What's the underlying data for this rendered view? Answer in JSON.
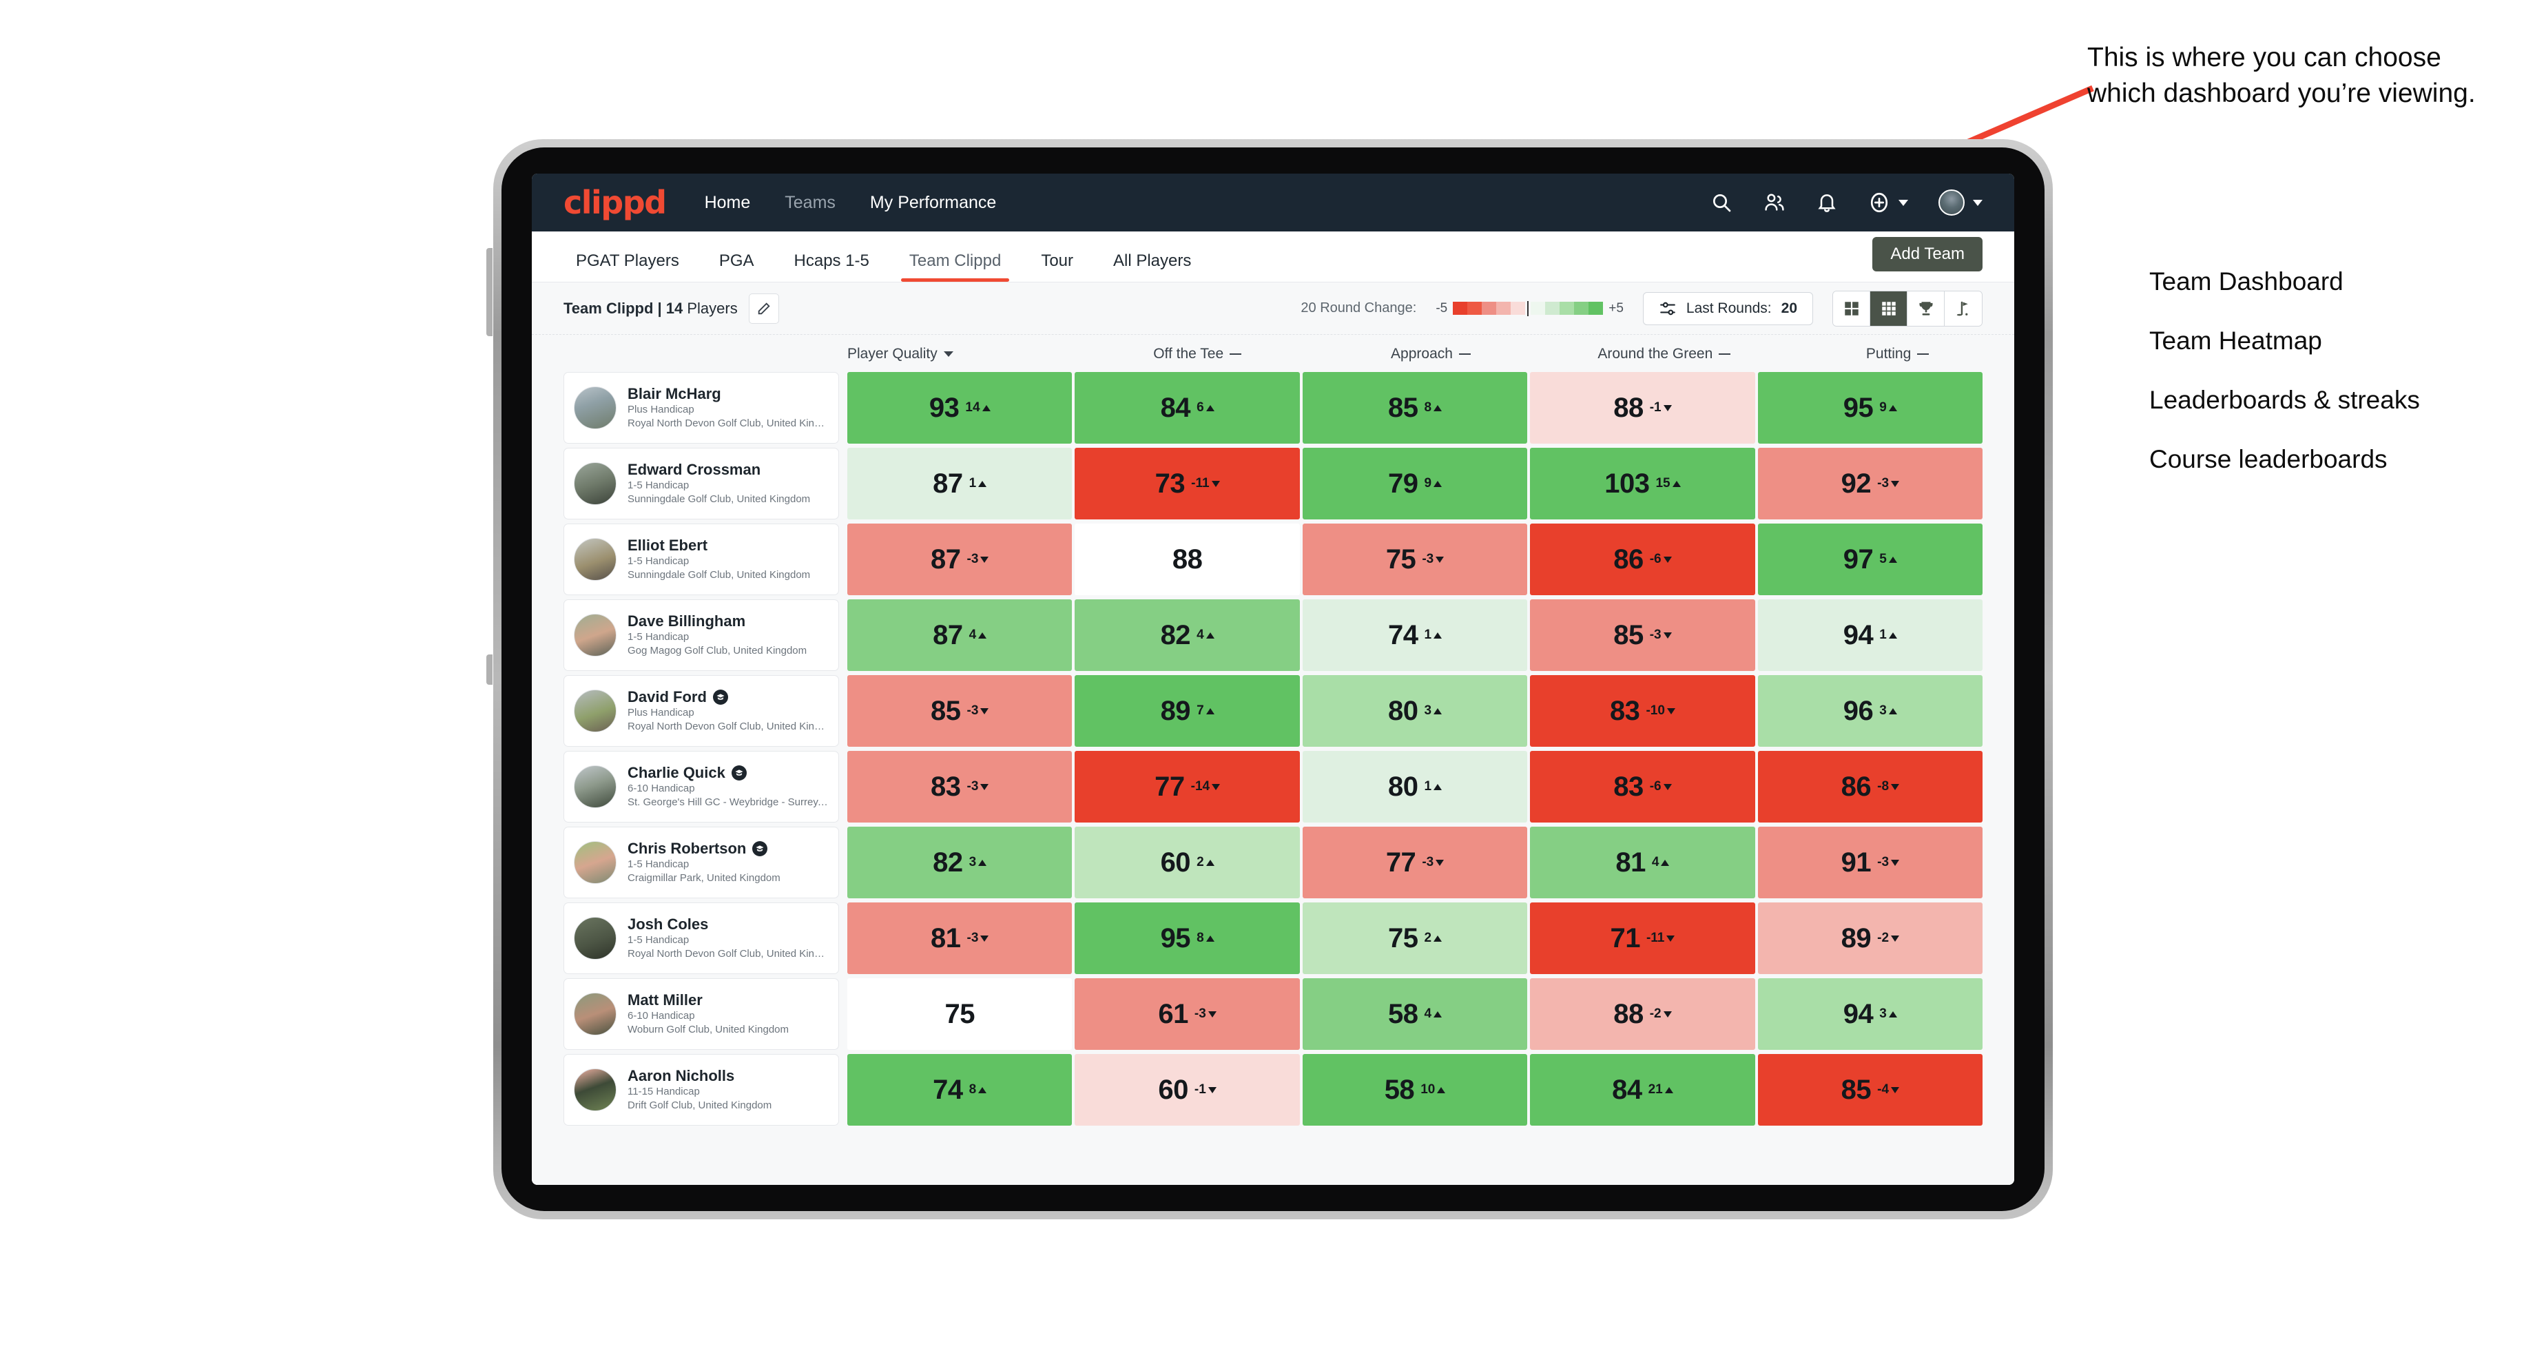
{
  "brand": {
    "logo_text": "clippd",
    "accent": "#f04a33"
  },
  "topnav": {
    "items": [
      {
        "label": "Home",
        "active": true
      },
      {
        "label": "Teams",
        "active": false
      },
      {
        "label": "My Performance",
        "active": false
      }
    ],
    "icons": [
      "search-icon",
      "people-icon",
      "bell-icon",
      "plus-circle-icon",
      "avatar"
    ]
  },
  "tabs": [
    {
      "label": "PGAT Players",
      "active": false
    },
    {
      "label": "PGA",
      "active": false
    },
    {
      "label": "Hcaps 1-5",
      "active": false
    },
    {
      "label": "Team Clippd",
      "active": true
    },
    {
      "label": "Tour",
      "active": false
    },
    {
      "label": "All Players",
      "active": false
    }
  ],
  "add_team_button": "Add Team",
  "controls": {
    "team_label_bold": "Team Clippd | 14",
    "team_label_rest": " Players",
    "edit_icon": "pencil-icon",
    "round_change_label": "20 Round Change:",
    "scale_min": "-5",
    "scale_max": "+5",
    "last_rounds_label": "Last Rounds:",
    "last_rounds_value": "20",
    "filter_icon": "sliders-icon",
    "views": [
      {
        "name": "team-dashboard",
        "icon": "grid-2x2-icon",
        "active": false
      },
      {
        "name": "team-heatmap",
        "icon": "grid-3x3-icon",
        "active": true
      },
      {
        "name": "leaderboards-streaks",
        "icon": "trophy-icon",
        "active": false
      },
      {
        "name": "course-leaderboards",
        "icon": "flag-icon",
        "active": false
      }
    ]
  },
  "columns": [
    {
      "label": "Player Quality",
      "indicator": "chevron-down-icon"
    },
    {
      "label": "Off the Tee",
      "indicator": "dash-icon"
    },
    {
      "label": "Approach",
      "indicator": "dash-icon"
    },
    {
      "label": "Around the Green",
      "indicator": "dash-icon"
    },
    {
      "label": "Putting",
      "indicator": "dash-icon"
    }
  ],
  "rows": [
    {
      "name": "Blair McHarg",
      "badge": false,
      "handicap": "Plus Handicap",
      "club": "Royal North Devon Golf Club, United Kingdom",
      "avatar_bg": "linear-gradient(160deg,#b9c3c9 0%,#8fa0a6 40%,#6f7c6b 100%)",
      "cells": [
        {
          "value": "93",
          "delta": "14",
          "dir": "up",
          "bg": "#61c263"
        },
        {
          "value": "84",
          "delta": "6",
          "dir": "up",
          "bg": "#61c263"
        },
        {
          "value": "85",
          "delta": "8",
          "dir": "up",
          "bg": "#61c263"
        },
        {
          "value": "88",
          "delta": "-1",
          "dir": "down",
          "bg": "#f9dcd9"
        },
        {
          "value": "95",
          "delta": "9",
          "dir": "up",
          "bg": "#61c263"
        }
      ]
    },
    {
      "name": "Edward Crossman",
      "badge": false,
      "handicap": "1-5 Handicap",
      "club": "Sunningdale Golf Club, United Kingdom",
      "avatar_bg": "linear-gradient(160deg,#9aa69a 0%,#6f7a6a 50%,#3c433a 100%)",
      "cells": [
        {
          "value": "87",
          "delta": "1",
          "dir": "up",
          "bg": "#dff0e1"
        },
        {
          "value": "73",
          "delta": "-11",
          "dir": "down",
          "bg": "#e8402c"
        },
        {
          "value": "79",
          "delta": "9",
          "dir": "up",
          "bg": "#61c263"
        },
        {
          "value": "103",
          "delta": "15",
          "dir": "up",
          "bg": "#61c263"
        },
        {
          "value": "92",
          "delta": "-3",
          "dir": "down",
          "bg": "#ee8f85"
        }
      ]
    },
    {
      "name": "Elliot Ebert",
      "badge": false,
      "handicap": "1-5 Handicap",
      "club": "Sunningdale Golf Club, United Kingdom",
      "avatar_bg": "linear-gradient(160deg,#c3c6c0 0%,#9b8f6e 55%,#56504a 100%)",
      "cells": [
        {
          "value": "87",
          "delta": "-3",
          "dir": "down",
          "bg": "#ee8f85"
        },
        {
          "value": "88",
          "delta": "",
          "dir": "none",
          "bg": "#ffffff"
        },
        {
          "value": "75",
          "delta": "-3",
          "dir": "down",
          "bg": "#ee8f85"
        },
        {
          "value": "86",
          "delta": "-6",
          "dir": "down",
          "bg": "#e8402c"
        },
        {
          "value": "97",
          "delta": "5",
          "dir": "up",
          "bg": "#61c263"
        }
      ]
    },
    {
      "name": "Dave Billingham",
      "badge": false,
      "handicap": "1-5 Handicap",
      "club": "Gog Magog Golf Club, United Kingdom",
      "avatar_bg": "linear-gradient(160deg,#9fae93 0%,#cfa68c 50%,#5d6358 100%)",
      "cells": [
        {
          "value": "87",
          "delta": "4",
          "dir": "up",
          "bg": "#85cf84"
        },
        {
          "value": "82",
          "delta": "4",
          "dir": "up",
          "bg": "#85cf84"
        },
        {
          "value": "74",
          "delta": "1",
          "dir": "up",
          "bg": "#dff0e1"
        },
        {
          "value": "85",
          "delta": "-3",
          "dir": "down",
          "bg": "#ee8f85"
        },
        {
          "value": "94",
          "delta": "1",
          "dir": "up",
          "bg": "#dff0e1"
        }
      ]
    },
    {
      "name": "David Ford",
      "badge": true,
      "handicap": "Plus Handicap",
      "club": "Royal North Devon Golf Club, United Kingdom",
      "avatar_bg": "linear-gradient(160deg,#b6bcc0 0%,#8fa06b 55%,#6b6054 100%)",
      "cells": [
        {
          "value": "85",
          "delta": "-3",
          "dir": "down",
          "bg": "#ee8f85"
        },
        {
          "value": "89",
          "delta": "7",
          "dir": "up",
          "bg": "#61c263"
        },
        {
          "value": "80",
          "delta": "3",
          "dir": "up",
          "bg": "#a9dea7"
        },
        {
          "value": "83",
          "delta": "-10",
          "dir": "down",
          "bg": "#e8402c"
        },
        {
          "value": "96",
          "delta": "3",
          "dir": "up",
          "bg": "#a9dea7"
        }
      ]
    },
    {
      "name": "Charlie Quick",
      "badge": true,
      "handicap": "6-10 Handicap",
      "club": "St. George's Hill GC - Weybridge - Surrey, Uni...",
      "avatar_bg": "linear-gradient(160deg,#c0c7cb 0%,#8e9a8c 45%,#3f4a3c 100%)",
      "cells": [
        {
          "value": "83",
          "delta": "-3",
          "dir": "down",
          "bg": "#ee8f85"
        },
        {
          "value": "77",
          "delta": "-14",
          "dir": "down",
          "bg": "#e8402c"
        },
        {
          "value": "80",
          "delta": "1",
          "dir": "up",
          "bg": "#dff0e1"
        },
        {
          "value": "83",
          "delta": "-6",
          "dir": "down",
          "bg": "#e8402c"
        },
        {
          "value": "86",
          "delta": "-8",
          "dir": "down",
          "bg": "#e8402c"
        }
      ]
    },
    {
      "name": "Chris Robertson",
      "badge": true,
      "handicap": "1-5 Handicap",
      "club": "Craigmillar Park, United Kingdom",
      "avatar_bg": "linear-gradient(160deg,#9fc07f 0%,#d6a68f 50%,#7d8a72 100%)",
      "cells": [
        {
          "value": "82",
          "delta": "3",
          "dir": "up",
          "bg": "#85cf84"
        },
        {
          "value": "60",
          "delta": "2",
          "dir": "up",
          "bg": "#bfe5bc"
        },
        {
          "value": "77",
          "delta": "-3",
          "dir": "down",
          "bg": "#ee8f85"
        },
        {
          "value": "81",
          "delta": "4",
          "dir": "up",
          "bg": "#85cf84"
        },
        {
          "value": "91",
          "delta": "-3",
          "dir": "down",
          "bg": "#ee8f85"
        }
      ]
    },
    {
      "name": "Josh Coles",
      "badge": false,
      "handicap": "1-5 Handicap",
      "club": "Royal North Devon Golf Club, United Kingdom",
      "avatar_bg": "linear-gradient(160deg,#6a7560 0%,#4d5645 55%,#2e3329 100%)",
      "cells": [
        {
          "value": "81",
          "delta": "-3",
          "dir": "down",
          "bg": "#ee8f85"
        },
        {
          "value": "95",
          "delta": "8",
          "dir": "up",
          "bg": "#61c263"
        },
        {
          "value": "75",
          "delta": "2",
          "dir": "up",
          "bg": "#bfe5bc"
        },
        {
          "value": "71",
          "delta": "-11",
          "dir": "down",
          "bg": "#e8402c"
        },
        {
          "value": "89",
          "delta": "-2",
          "dir": "down",
          "bg": "#f3b5ae"
        }
      ]
    },
    {
      "name": "Matt Miller",
      "badge": false,
      "handicap": "6-10 Handicap",
      "club": "Woburn Golf Club, United Kingdom",
      "avatar_bg": "linear-gradient(160deg,#8b9a7d 0%,#b98f78 50%,#4a5240 100%)",
      "cells": [
        {
          "value": "75",
          "delta": "",
          "dir": "none",
          "bg": "#ffffff"
        },
        {
          "value": "61",
          "delta": "-3",
          "dir": "down",
          "bg": "#ee8f85"
        },
        {
          "value": "58",
          "delta": "4",
          "dir": "up",
          "bg": "#85cf84"
        },
        {
          "value": "88",
          "delta": "-2",
          "dir": "down",
          "bg": "#f3b5ae"
        },
        {
          "value": "94",
          "delta": "3",
          "dir": "up",
          "bg": "#a9dea7"
        }
      ]
    },
    {
      "name": "Aaron Nicholls",
      "badge": false,
      "handicap": "11-15 Handicap",
      "club": "Drift Golf Club, United Kingdom",
      "avatar_bg": "linear-gradient(160deg,#f0b2a4 0%,#3d4a37 45%,#6f8354 100%)",
      "cells": [
        {
          "value": "74",
          "delta": "8",
          "dir": "up",
          "bg": "#61c263"
        },
        {
          "value": "60",
          "delta": "-1",
          "dir": "down",
          "bg": "#f9dcd9"
        },
        {
          "value": "58",
          "delta": "10",
          "dir": "up",
          "bg": "#61c263"
        },
        {
          "value": "84",
          "delta": "21",
          "dir": "up",
          "bg": "#61c263"
        },
        {
          "value": "85",
          "delta": "-4",
          "dir": "down",
          "bg": "#e8402c"
        }
      ]
    }
  ],
  "annotation": {
    "callout": "This is where you can choose which dashboard you’re viewing.",
    "items": [
      "Team Dashboard",
      "Team Heatmap",
      "Leaderboards & streaks",
      "Course leaderboards"
    ],
    "arrow_color": "#ef4230"
  },
  "scale_swatches": [
    "#e8402c",
    "#ee5a44",
    "#ee8f85",
    "#f3b5ae",
    "#f9dcd9",
    "#eef7ef",
    "#cfead0",
    "#a9dea7",
    "#85cf84",
    "#61c263"
  ]
}
